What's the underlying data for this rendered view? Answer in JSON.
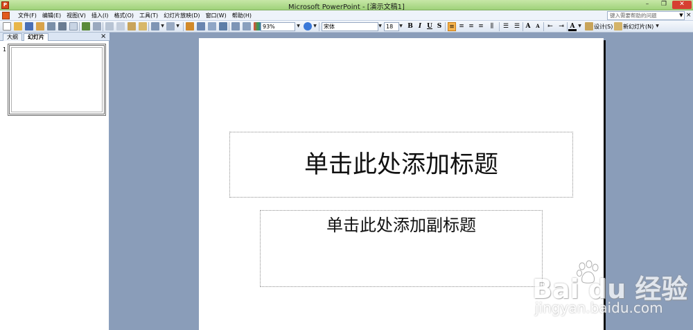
{
  "window": {
    "title": "Microsoft PowerPoint - [演示文稿1]",
    "minimize_glyph": "–",
    "maximize_glyph": "❐",
    "close_glyph": "✕"
  },
  "menu": {
    "items": [
      "文件(F)",
      "编辑(E)",
      "视图(V)",
      "插入(I)",
      "格式(O)",
      "工具(T)",
      "幻灯片放映(D)",
      "窗口(W)",
      "帮助(H)"
    ],
    "help_placeholder": "键入需要帮助的问题",
    "doc_close_glyph": "×"
  },
  "toolbar": {
    "zoom": "93%",
    "font_name": "宋体",
    "font_size": "18",
    "bold": "B",
    "italic": "I",
    "underline": "U",
    "shadow": "S",
    "grow_font": "A",
    "shrink_font": "A",
    "font_color": "A",
    "design_label": "设计(S)",
    "new_slide_label": "新幻灯片(N)",
    "accent_active": "#f7b44e"
  },
  "left_pane": {
    "tabs": [
      "大纲",
      "幻灯片"
    ],
    "active_tab": "幻灯片",
    "close_glyph": "×",
    "slide_numbers": [
      "1"
    ]
  },
  "slide": {
    "title_placeholder": "单击此处添加标题",
    "subtitle_placeholder": "单击此处添加副标题"
  },
  "watermark": {
    "main": "Bai du 经验",
    "sub": "jingyan.baidu.com"
  },
  "colors": {
    "titlebar": "#b2dd8e",
    "workspace": "#8a9db9",
    "menubar": "#eef3fa"
  }
}
